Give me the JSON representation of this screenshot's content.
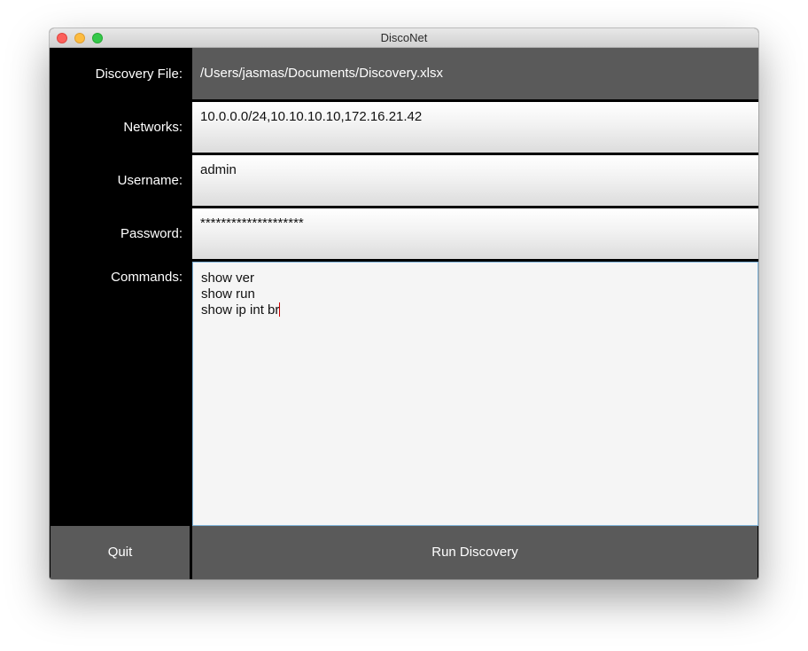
{
  "window": {
    "title": "DiscoNet"
  },
  "form": {
    "discovery_file": {
      "label": "Discovery File:",
      "value": "/Users/jasmas/Documents/Discovery.xlsx"
    },
    "networks": {
      "label": "Networks:",
      "value": "10.0.0.0/24,10.10.10.10,172.16.21.42"
    },
    "username": {
      "label": "Username:",
      "value": "admin"
    },
    "password": {
      "label": "Password:",
      "value": "********************"
    },
    "commands": {
      "label": "Commands:",
      "value": "show ver\nshow run\nshow ip int br"
    }
  },
  "buttons": {
    "quit_label": "Quit",
    "run_label": "Run Discovery"
  }
}
